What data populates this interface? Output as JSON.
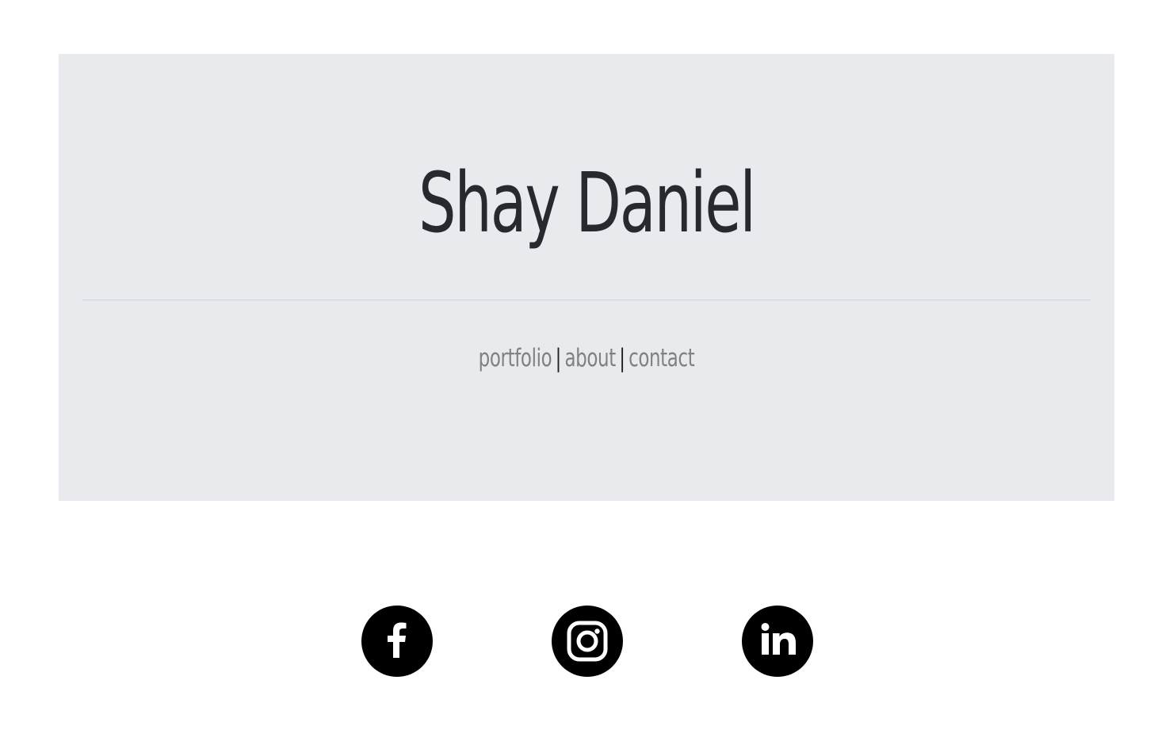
{
  "header": {
    "title": "Shay Daniel"
  },
  "nav": {
    "items": [
      {
        "label": "portfolio"
      },
      {
        "label": "about"
      },
      {
        "label": "contact"
      }
    ],
    "separator": "|"
  },
  "social": [
    {
      "icon": "facebook-icon"
    },
    {
      "icon": "instagram-icon"
    },
    {
      "icon": "linkedin-icon"
    }
  ],
  "colors": {
    "hero_background": "#e9eaee",
    "title": "#262a2e",
    "nav_link": "#7f8184",
    "separator": "#1e2124",
    "icon_background": "#000000"
  }
}
